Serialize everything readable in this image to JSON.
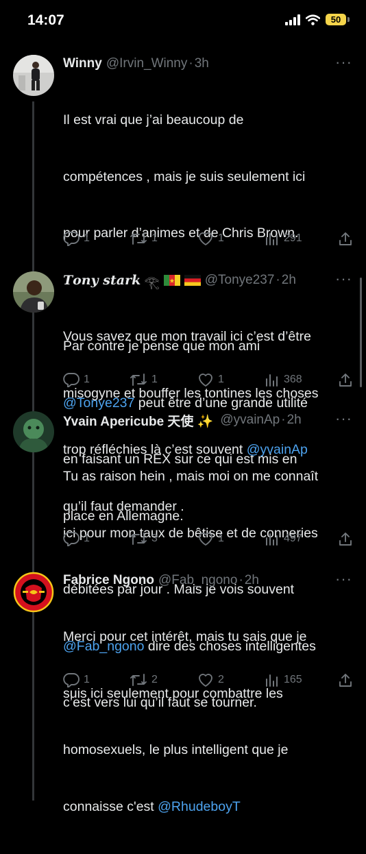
{
  "status": {
    "time": "14:07",
    "battery": "50"
  },
  "tweets": [
    {
      "name": "Winny",
      "handle": "@Irvin_Winny",
      "time": "3h",
      "lines": [
        {
          "t": "Il est vrai que j’ai beaucoup de"
        },
        {
          "t": "compétences , mais je suis seulement ici"
        },
        {
          "t": "pour parler d’animes et de Chris Brown."
        },
        {
          "t": ""
        },
        {
          "t": "Par contre je pense que mon ami"
        },
        {
          "m": "@Tonye237",
          "t": " peut être d’une grande utilité"
        },
        {
          "t": "en faisant un REX sur ce qui est mis en"
        },
        {
          "t": "place en Allemagne."
        }
      ],
      "replies": "1",
      "retweets": "1",
      "likes": "1",
      "views": "291"
    },
    {
      "name": "𝑻𝒐𝒏𝒚 𝒔𝒕𝒂𝒓𝒌",
      "handle": "@Tonye237",
      "time": "2h",
      "lines": [
        {
          "t": "Vous savez que mon travail ici c’est d’être"
        },
        {
          "t": "misogyne et bouffer les tontines les choses"
        },
        {
          "t": "trop réfléchies là c’est souvent ",
          "m": "@yvainAp"
        },
        {
          "t": "qu’il faut demander ."
        }
      ],
      "replies": "1",
      "retweets": "1",
      "likes": "1",
      "views": "368"
    },
    {
      "name": "Yvain Apericube 天使 ✨",
      "handle": "@yvainAp",
      "time": "2h",
      "lines": [
        {
          "t": "Tu as raison hein , mais moi on me connaît"
        },
        {
          "t": "ici pour mon taux de bêtise et de conneries"
        },
        {
          "t": "débitées par jour . Mais je vois souvent"
        },
        {
          "m": "@Fab_ngono",
          "t": " dire des choses intelligentes"
        },
        {
          "t": "c’est vers lui qu’il faut se tourner."
        }
      ],
      "replies": "1",
      "retweets": "3",
      "likes": "1",
      "views": "497"
    },
    {
      "name": "Fabrice Ngono",
      "handle": "@Fab_ngono",
      "time": "2h",
      "lines": [
        {
          "t": "Merci pour cet intérêt, mais tu sais que je"
        },
        {
          "t": "suis ici seulement pour combattre les"
        },
        {
          "t": "homosexuels, le plus intelligent que je"
        },
        {
          "t": "connaisse c'est ",
          "m": "@RhudeboyT"
        }
      ],
      "replies": "1",
      "retweets": "2",
      "likes": "2",
      "views": "165"
    }
  ],
  "badge_text": "MANCHESTER UNITED",
  "icons": {
    "reply": "reply-icon",
    "retweet": "retweet-icon",
    "like": "heart-icon",
    "views": "views-icon",
    "share": "share-icon",
    "more": "more-icon"
  },
  "colors": {
    "mention": "#4da3ef",
    "muted": "#71767b",
    "background": "#000000"
  }
}
